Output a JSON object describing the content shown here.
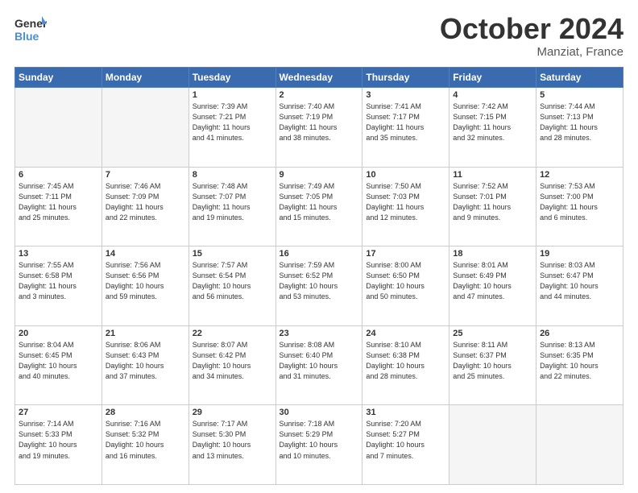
{
  "logo": {
    "text_general": "General",
    "text_blue": "Blue"
  },
  "header": {
    "month": "October 2024",
    "location": "Manziat, France"
  },
  "weekdays": [
    "Sunday",
    "Monday",
    "Tuesday",
    "Wednesday",
    "Thursday",
    "Friday",
    "Saturday"
  ],
  "weeks": [
    [
      {
        "day": "",
        "info": "",
        "empty": true
      },
      {
        "day": "",
        "info": "",
        "empty": true
      },
      {
        "day": "1",
        "info": "Sunrise: 7:39 AM\nSunset: 7:21 PM\nDaylight: 11 hours\nand 41 minutes."
      },
      {
        "day": "2",
        "info": "Sunrise: 7:40 AM\nSunset: 7:19 PM\nDaylight: 11 hours\nand 38 minutes."
      },
      {
        "day": "3",
        "info": "Sunrise: 7:41 AM\nSunset: 7:17 PM\nDaylight: 11 hours\nand 35 minutes."
      },
      {
        "day": "4",
        "info": "Sunrise: 7:42 AM\nSunset: 7:15 PM\nDaylight: 11 hours\nand 32 minutes."
      },
      {
        "day": "5",
        "info": "Sunrise: 7:44 AM\nSunset: 7:13 PM\nDaylight: 11 hours\nand 28 minutes."
      }
    ],
    [
      {
        "day": "6",
        "info": "Sunrise: 7:45 AM\nSunset: 7:11 PM\nDaylight: 11 hours\nand 25 minutes."
      },
      {
        "day": "7",
        "info": "Sunrise: 7:46 AM\nSunset: 7:09 PM\nDaylight: 11 hours\nand 22 minutes."
      },
      {
        "day": "8",
        "info": "Sunrise: 7:48 AM\nSunset: 7:07 PM\nDaylight: 11 hours\nand 19 minutes."
      },
      {
        "day": "9",
        "info": "Sunrise: 7:49 AM\nSunset: 7:05 PM\nDaylight: 11 hours\nand 15 minutes."
      },
      {
        "day": "10",
        "info": "Sunrise: 7:50 AM\nSunset: 7:03 PM\nDaylight: 11 hours\nand 12 minutes."
      },
      {
        "day": "11",
        "info": "Sunrise: 7:52 AM\nSunset: 7:01 PM\nDaylight: 11 hours\nand 9 minutes."
      },
      {
        "day": "12",
        "info": "Sunrise: 7:53 AM\nSunset: 7:00 PM\nDaylight: 11 hours\nand 6 minutes."
      }
    ],
    [
      {
        "day": "13",
        "info": "Sunrise: 7:55 AM\nSunset: 6:58 PM\nDaylight: 11 hours\nand 3 minutes."
      },
      {
        "day": "14",
        "info": "Sunrise: 7:56 AM\nSunset: 6:56 PM\nDaylight: 10 hours\nand 59 minutes."
      },
      {
        "day": "15",
        "info": "Sunrise: 7:57 AM\nSunset: 6:54 PM\nDaylight: 10 hours\nand 56 minutes."
      },
      {
        "day": "16",
        "info": "Sunrise: 7:59 AM\nSunset: 6:52 PM\nDaylight: 10 hours\nand 53 minutes."
      },
      {
        "day": "17",
        "info": "Sunrise: 8:00 AM\nSunset: 6:50 PM\nDaylight: 10 hours\nand 50 minutes."
      },
      {
        "day": "18",
        "info": "Sunrise: 8:01 AM\nSunset: 6:49 PM\nDaylight: 10 hours\nand 47 minutes."
      },
      {
        "day": "19",
        "info": "Sunrise: 8:03 AM\nSunset: 6:47 PM\nDaylight: 10 hours\nand 44 minutes."
      }
    ],
    [
      {
        "day": "20",
        "info": "Sunrise: 8:04 AM\nSunset: 6:45 PM\nDaylight: 10 hours\nand 40 minutes."
      },
      {
        "day": "21",
        "info": "Sunrise: 8:06 AM\nSunset: 6:43 PM\nDaylight: 10 hours\nand 37 minutes."
      },
      {
        "day": "22",
        "info": "Sunrise: 8:07 AM\nSunset: 6:42 PM\nDaylight: 10 hours\nand 34 minutes."
      },
      {
        "day": "23",
        "info": "Sunrise: 8:08 AM\nSunset: 6:40 PM\nDaylight: 10 hours\nand 31 minutes."
      },
      {
        "day": "24",
        "info": "Sunrise: 8:10 AM\nSunset: 6:38 PM\nDaylight: 10 hours\nand 28 minutes."
      },
      {
        "day": "25",
        "info": "Sunrise: 8:11 AM\nSunset: 6:37 PM\nDaylight: 10 hours\nand 25 minutes."
      },
      {
        "day": "26",
        "info": "Sunrise: 8:13 AM\nSunset: 6:35 PM\nDaylight: 10 hours\nand 22 minutes."
      }
    ],
    [
      {
        "day": "27",
        "info": "Sunrise: 7:14 AM\nSunset: 5:33 PM\nDaylight: 10 hours\nand 19 minutes."
      },
      {
        "day": "28",
        "info": "Sunrise: 7:16 AM\nSunset: 5:32 PM\nDaylight: 10 hours\nand 16 minutes."
      },
      {
        "day": "29",
        "info": "Sunrise: 7:17 AM\nSunset: 5:30 PM\nDaylight: 10 hours\nand 13 minutes."
      },
      {
        "day": "30",
        "info": "Sunrise: 7:18 AM\nSunset: 5:29 PM\nDaylight: 10 hours\nand 10 minutes."
      },
      {
        "day": "31",
        "info": "Sunrise: 7:20 AM\nSunset: 5:27 PM\nDaylight: 10 hours\nand 7 minutes."
      },
      {
        "day": "",
        "info": "",
        "empty": true
      },
      {
        "day": "",
        "info": "",
        "empty": true
      }
    ]
  ]
}
